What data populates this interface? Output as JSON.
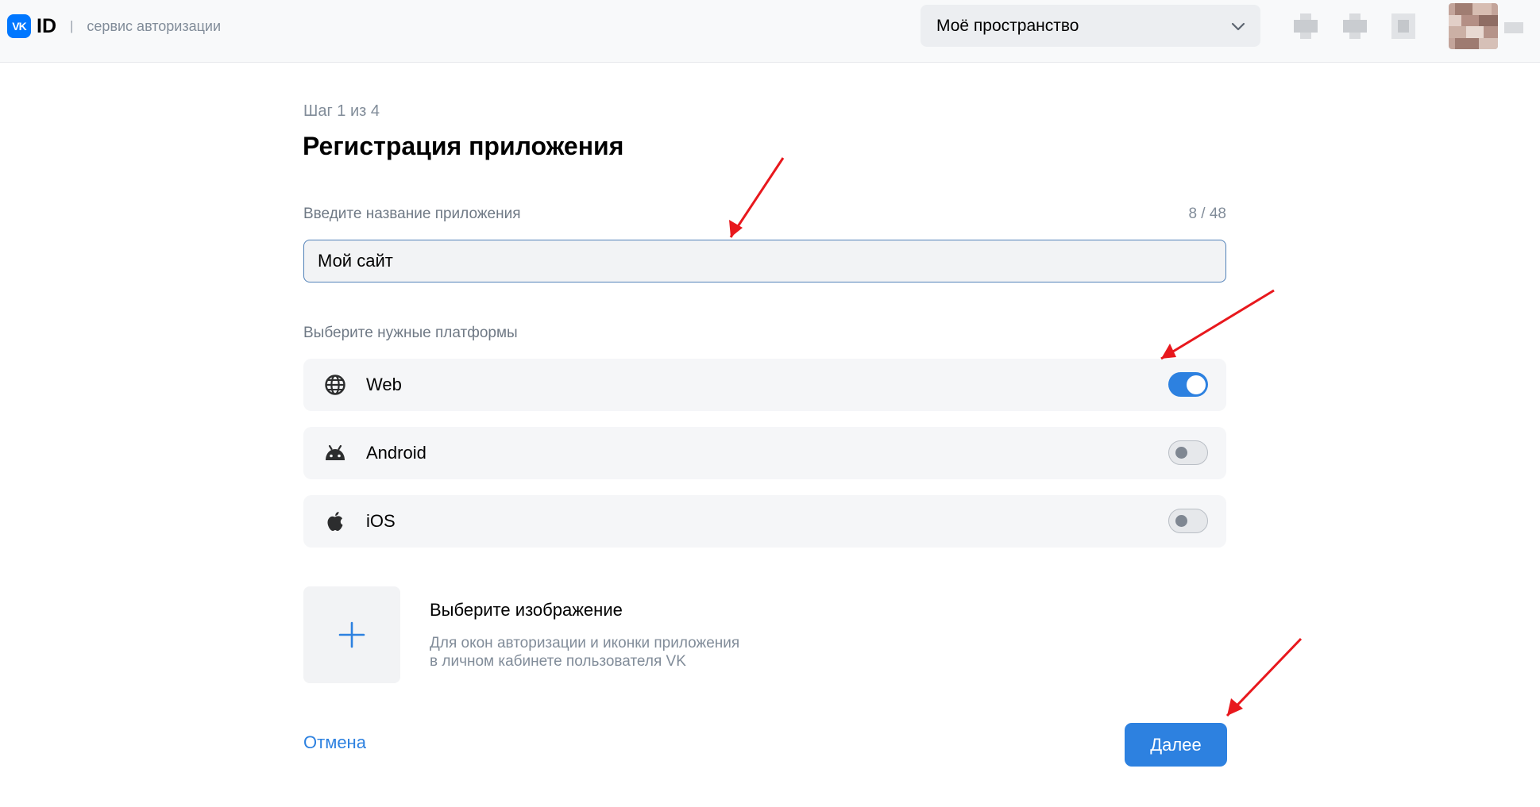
{
  "header": {
    "logo_badge": "VK",
    "logo_id": "ID",
    "separator": "|",
    "subtitle": "сервис авторизации",
    "space_selector": {
      "value": "Моё пространство",
      "icon": "chevron-down-icon"
    }
  },
  "page": {
    "step": "Шаг 1 из 4",
    "title": "Регистрация приложения"
  },
  "name_field": {
    "label": "Введите название приложения",
    "value": "Мой сайт",
    "counter": "8 / 48"
  },
  "platforms": {
    "label": "Выберите нужные платформы",
    "items": [
      {
        "name": "Web",
        "icon": "globe-icon",
        "enabled": true
      },
      {
        "name": "Android",
        "icon": "android-icon",
        "enabled": false
      },
      {
        "name": "iOS",
        "icon": "apple-icon",
        "enabled": false
      }
    ]
  },
  "image_upload": {
    "title": "Выберите изображение",
    "description_line1": "Для окон авторизации и иконки приложения",
    "description_line2": "в личном кабинете пользователя VK",
    "icon": "plus-icon"
  },
  "actions": {
    "cancel_label": "Отмена",
    "next_label": "Далее"
  },
  "colors": {
    "accent": "#2d81e0",
    "brand": "#0077ff",
    "annotation_arrow": "#e8181d"
  }
}
